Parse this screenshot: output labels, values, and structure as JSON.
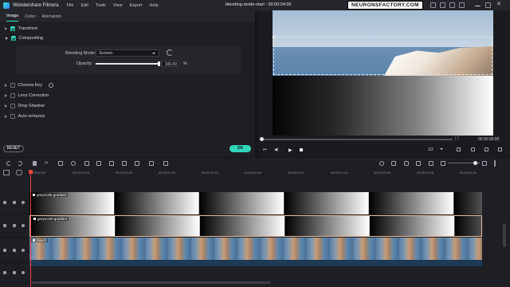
{
  "app": {
    "title": "Wondershare Filmora",
    "menu": [
      "File",
      "Edit",
      "Tools",
      "View",
      "Export",
      "Help"
    ],
    "document_title": "blending-mode-start : 00:00:04:05",
    "watermark": "NEURONSFACTORY.COM"
  },
  "tabs": [
    {
      "label": "Image",
      "active": true
    },
    {
      "label": "Color",
      "active": false
    },
    {
      "label": "Animation",
      "active": false
    }
  ],
  "sections": {
    "transform": "Transform",
    "compositing": "Compositing",
    "chroma_key": "Chroma Key",
    "lens_correction": "Lens Correction",
    "drop_shadow": "Drop Shadow",
    "auto_enhance": "Auto enhance"
  },
  "compositing": {
    "blending_mode_label": "Blending Mode:",
    "blending_mode_value": "Screen",
    "opacity_label": "Opacity:",
    "opacity_value": "100.00",
    "opacity_unit": "%",
    "opacity_fraction": 1.0
  },
  "buttons": {
    "reset": "RESET",
    "ok": "OK"
  },
  "preview": {
    "time": "00:00:00:00",
    "quality": "1/2",
    "progress_fraction": 0.0
  },
  "timeline": {
    "ruler": [
      "00:00:00:00",
      "00:00:00:10",
      "00:00:00:20",
      "00:00:01:05",
      "00:00:01:15",
      "00:00:02:00",
      "00:00:02:10",
      "00:00:02:20",
      "00:00:03:05",
      "00:00:03:15",
      "00:00:04:00"
    ],
    "tracks": [
      {
        "clip_label": "grayscale-gradient"
      },
      {
        "clip_label": "grayscale-gradient"
      },
      {
        "clip_label": "beach"
      }
    ]
  },
  "colors": {
    "accent": "#33d6bd",
    "playhead": "#e9443a",
    "selected_clip_border": "#e4b79b"
  }
}
